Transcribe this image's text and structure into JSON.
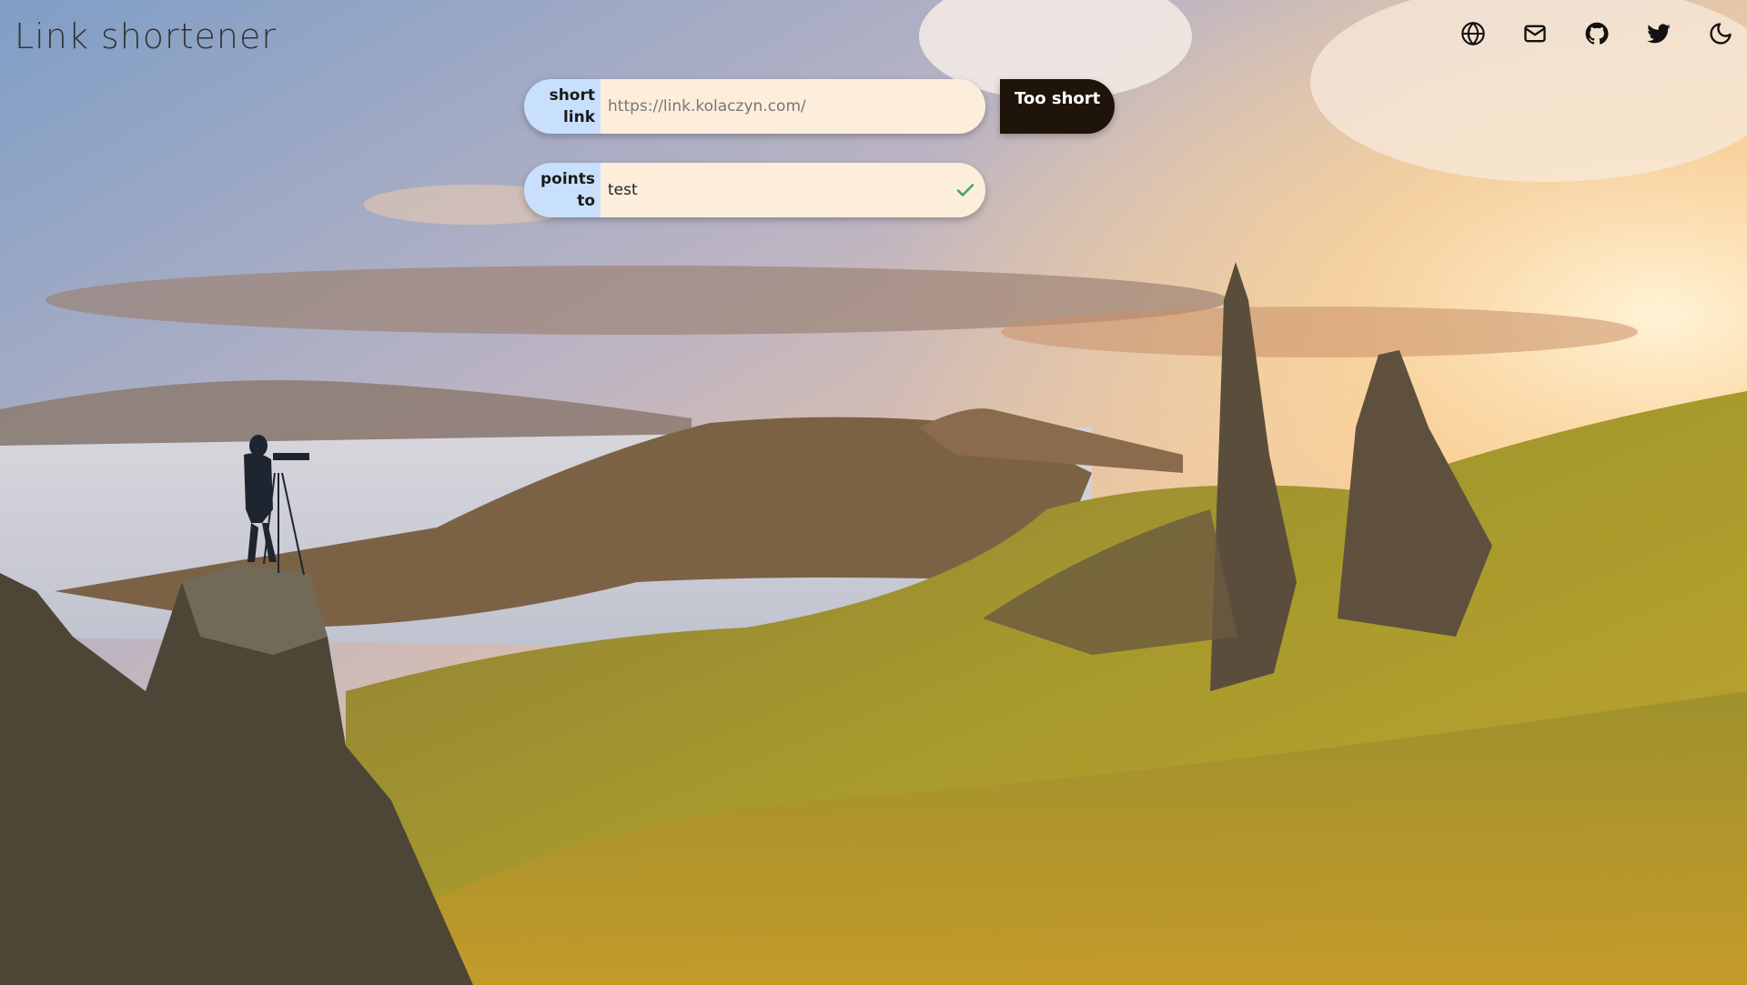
{
  "app": {
    "title": "Link shortener"
  },
  "header": {
    "icons": [
      {
        "name": "globe-icon",
        "label": "language"
      },
      {
        "name": "mail-icon",
        "label": "contact"
      },
      {
        "name": "github-icon",
        "label": "github"
      },
      {
        "name": "twitter-icon",
        "label": "twitter"
      },
      {
        "name": "moon-icon",
        "label": "dark mode"
      }
    ]
  },
  "form": {
    "short_link": {
      "label_line1": "short",
      "label_line2": "link",
      "value": "",
      "placeholder": "https://link.kolaczyn.com/"
    },
    "points_to": {
      "label_line1": "points",
      "label_line2": "to",
      "value": "test",
      "valid": true
    },
    "submit_label": "Too short"
  },
  "colors": {
    "label_bg": "#c8e0fb",
    "input_bg": "#fdeedc",
    "button_bg": "#1e140a",
    "check": "#3aa76d"
  }
}
